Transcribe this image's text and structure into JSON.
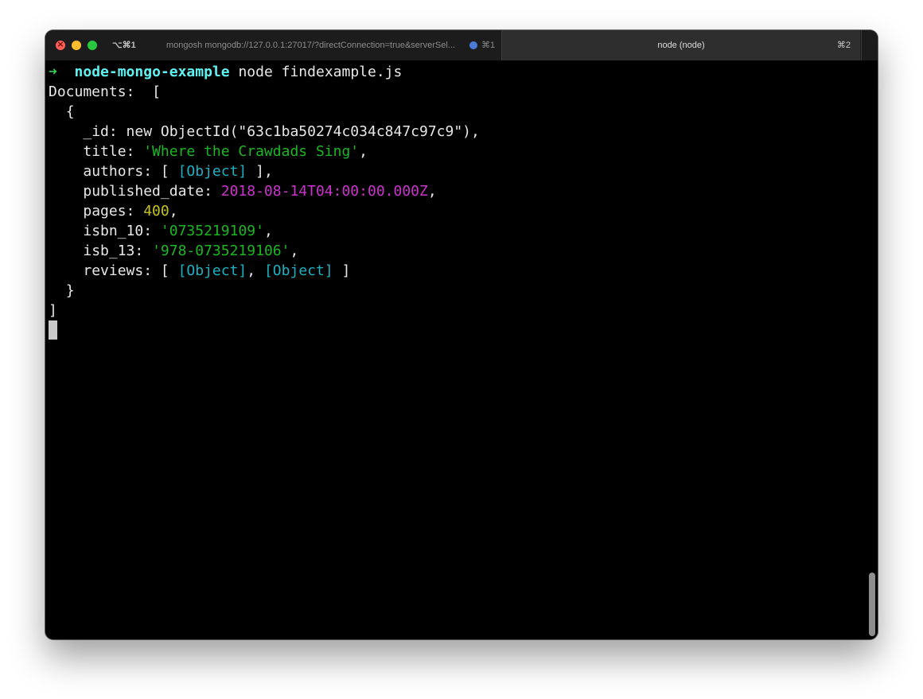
{
  "titlebar": {
    "tab1": {
      "shortcut": "⌥⌘1",
      "title": "mongosh mongodb://127.0.0.1:27017/?directConnection=true&serverSel...",
      "number": "⌘1"
    },
    "tab2": {
      "title": "node (node)",
      "number": "⌘2"
    }
  },
  "terminal": {
    "prompt_arrow": "➜",
    "prompt_dir": "node-mongo-example",
    "command": "node findexample.js",
    "documents_label": "Documents:",
    "open_array": "[",
    "open_brace": "{",
    "fields": {
      "id_key": "_id: ",
      "id_value": "new ObjectId(\"63c1ba50274c034c847c97c9\"),",
      "title_key": "title: ",
      "title_value": "'Where the Crawdads Sing'",
      "authors_key": "authors: [ ",
      "authors_obj": "[Object]",
      "authors_end": " ],",
      "published_key": "published_date: ",
      "published_value": "2018-08-14T04:00:00.000Z",
      "pages_key": "pages: ",
      "pages_value": "400",
      "isbn10_key": "isbn_10: ",
      "isbn10_value": "'0735219109'",
      "isb13_key": "isb_13: ",
      "isb13_value": "'978-0735219106'",
      "reviews_key": "reviews: [ ",
      "reviews_obj1": "[Object]",
      "reviews_sep": ", ",
      "reviews_obj2": "[Object]",
      "reviews_end": " ]"
    },
    "close_brace": "}",
    "close_array": "]"
  },
  "colors": {
    "background": "#000000",
    "prompt_arrow": "#35d04c",
    "prompt_dir": "#5ef3f3",
    "string": "#17b820",
    "object_ref": "#19b2c4",
    "date": "#cc33cc",
    "number": "#c6c40e",
    "default_text": "#e8e8e8"
  },
  "icons": {
    "close": "close-traffic-light",
    "minimize": "minimize-traffic-light",
    "maximize": "maximize-traffic-light",
    "activity": "activity-dot-icon"
  }
}
